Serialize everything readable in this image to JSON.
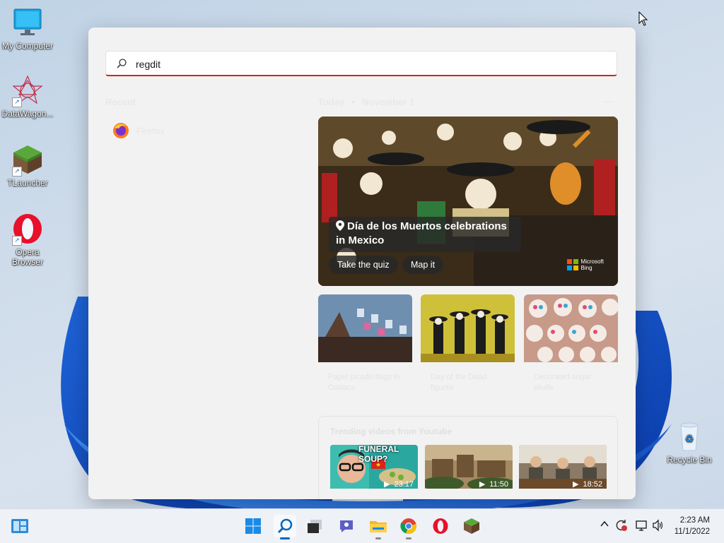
{
  "desktop": {
    "icons": [
      {
        "label": "My Computer"
      },
      {
        "label": "DataWagon..."
      },
      {
        "label": "TLauncher"
      },
      {
        "label": "Opera Browser"
      },
      {
        "label": "Recycle Bin"
      }
    ]
  },
  "start": {
    "search": {
      "value": "regdit",
      "placeholder": ""
    },
    "recent": {
      "title": "Recent",
      "items": [
        {
          "label": "Firefox",
          "icon": "firefox-icon"
        }
      ]
    },
    "today": {
      "label": "Today",
      "separator": "•",
      "date": "November 1",
      "more": "···"
    },
    "hero": {
      "title": "Día de los Muertos celebrations in Mexico",
      "buttons": [
        "Take the quiz",
        "Map it"
      ],
      "brand_line1": "Microsoft",
      "brand_line2": "Bing"
    },
    "cards": [
      {
        "caption": "Papel picado flags in Oaxaca"
      },
      {
        "caption": "Day of the Dead figures"
      },
      {
        "caption": "Decorated sugar skulls"
      }
    ],
    "videos": {
      "title": "Trending videos from Youtube",
      "items": [
        {
          "overlay": "FUNERAL SOUP?",
          "duration": "23:17"
        },
        {
          "overlay": "",
          "duration": "11:50"
        },
        {
          "overlay": "",
          "duration": "18:52"
        }
      ]
    }
  },
  "taskbar": {
    "apps": [
      "start-icon",
      "search-icon",
      "task-view-icon",
      "chat-icon",
      "file-explorer-icon",
      "chrome-icon",
      "opera-icon",
      "tlauncher-icon"
    ],
    "time": "2:23 AM",
    "date": "11/1/2022"
  },
  "colors": {
    "accent": "#0067c0",
    "search_underline": "#c42b1c"
  }
}
